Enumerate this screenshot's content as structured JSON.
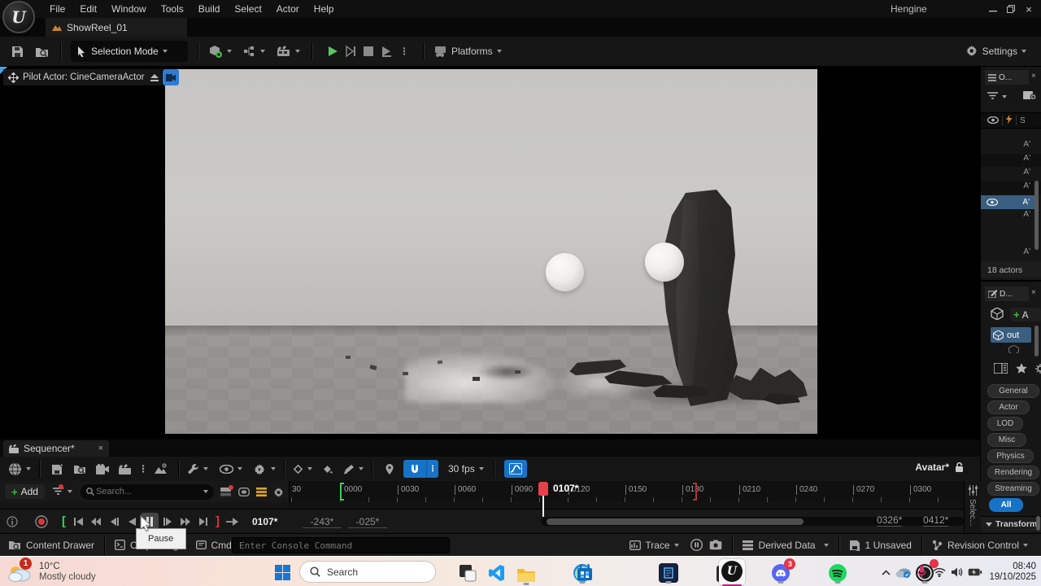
{
  "window": {
    "title": "Hengine"
  },
  "menu": {
    "items": [
      "File",
      "Edit",
      "Window",
      "Tools",
      "Build",
      "Select",
      "Actor",
      "Help"
    ]
  },
  "tabs": {
    "asset": "ShowReel_01"
  },
  "toolbar": {
    "mode": "Selection Mode",
    "platforms": "Platforms",
    "settings": "Settings"
  },
  "viewport": {
    "pilot": "Pilot Actor: CineCameraActor"
  },
  "outliner": {
    "tab": "O...",
    "col": "S",
    "rows": [
      "A'",
      "A'",
      "A'",
      "A'",
      "A'",
      "A'",
      "A'"
    ],
    "footer": "18 actors"
  },
  "details": {
    "tab": "D...",
    "add": "A",
    "item": "out",
    "chips": [
      "General",
      "Actor",
      "LOD",
      "Misc",
      "Physics",
      "Rendering",
      "Streaming",
      "All"
    ],
    "section": "Transform"
  },
  "sequencer": {
    "tab": "Sequencer*",
    "add": "Add",
    "search": "Search...",
    "fps": "30 fps",
    "avatar": "Avatar*",
    "frame": "0107*",
    "in": "-243*",
    "out": "-025*",
    "end1": "0326*",
    "end2": "0412*",
    "selec": "Selec...",
    "ruler": [
      "30",
      "0000",
      "0030",
      "0060",
      "0090",
      "0120",
      "0150",
      "0180",
      "0210",
      "0240",
      "0270",
      "0300"
    ]
  },
  "tooltip": {
    "pause": "Pause"
  },
  "statusbar": {
    "content_drawer": "Content Drawer",
    "output": "Output Log",
    "cmd": "Cmd",
    "console": "Enter Console Command",
    "trace": "Trace",
    "derived": "Derived Data",
    "unsaved": "1 Unsaved",
    "revision": "Revision Control"
  },
  "taskbar": {
    "badge": "1",
    "temp": "10°C",
    "cond": "Mostly cloudy",
    "search": "Search",
    "discord_badge": "3",
    "time": "08:40",
    "date": "19/10/2025"
  },
  "colors": {
    "accent_blue": "#1673c8",
    "play_green": "#5cc85c",
    "record_red": "#d63a3a",
    "selection_blue": "#3a5e80",
    "tab_orange": "#c9862b",
    "taskbar_magenta": "#bf1a83"
  }
}
